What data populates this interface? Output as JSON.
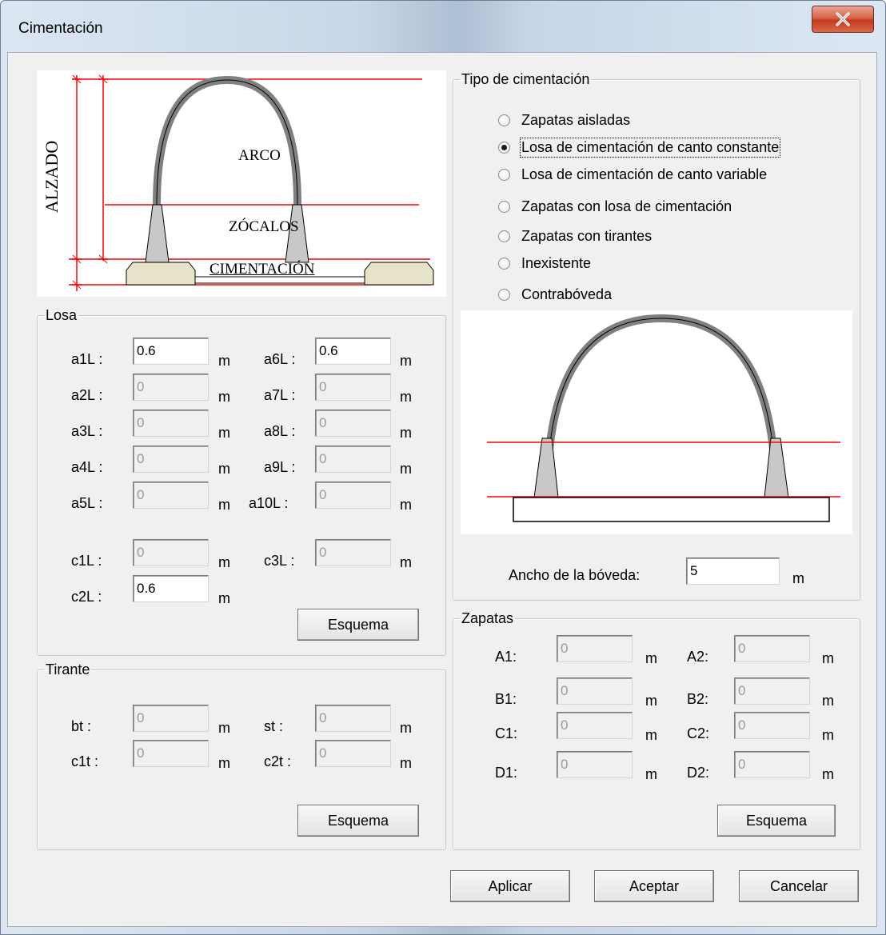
{
  "window": {
    "title": "Cimentación",
    "close_icon": "close-icon"
  },
  "elevation_diagram": {
    "side_label": "ALZADO",
    "arch_label": "ARCO",
    "plinth_label": "ZÓCALOS",
    "foundation_label": "CIMENTACIÓN"
  },
  "losa": {
    "legend": "Losa",
    "left": [
      {
        "label": "a1L :",
        "value": "0.6",
        "enabled": true,
        "unit": "m"
      },
      {
        "label": "a2L :",
        "value": "0",
        "enabled": false,
        "unit": "m"
      },
      {
        "label": "a3L :",
        "value": "0",
        "enabled": false,
        "unit": "m"
      },
      {
        "label": "a4L :",
        "value": "0",
        "enabled": false,
        "unit": "m"
      },
      {
        "label": "a5L :",
        "value": "0",
        "enabled": false,
        "unit": "m"
      },
      {
        "label": "c1L :",
        "value": "0",
        "enabled": false,
        "unit": "m"
      },
      {
        "label": "c2L :",
        "value": "0.6",
        "enabled": true,
        "unit": "m"
      }
    ],
    "right": [
      {
        "label": "a6L :",
        "value": "0.6",
        "enabled": true,
        "unit": "m"
      },
      {
        "label": "a7L :",
        "value": "0",
        "enabled": false,
        "unit": "m"
      },
      {
        "label": "a8L :",
        "value": "0",
        "enabled": false,
        "unit": "m"
      },
      {
        "label": "a9L :",
        "value": "0",
        "enabled": false,
        "unit": "m"
      },
      {
        "label": "a10L :",
        "value": "0",
        "enabled": false,
        "unit": "m"
      },
      {
        "label": "c3L :",
        "value": "0",
        "enabled": false,
        "unit": "m"
      }
    ],
    "scheme_button": "Esquema"
  },
  "tirante": {
    "legend": "Tirante",
    "fields": [
      {
        "label": "bt :",
        "value": "0",
        "unit": "m"
      },
      {
        "label": "st :",
        "value": "0",
        "unit": "m"
      },
      {
        "label": "c1t :",
        "value": "0",
        "unit": "m"
      },
      {
        "label": "c2t :",
        "value": "0",
        "unit": "m"
      }
    ],
    "scheme_button": "Esquema"
  },
  "tipo": {
    "legend": "Tipo de cimentación",
    "options": [
      {
        "label": "Zapatas aisladas",
        "selected": false
      },
      {
        "label": "Losa de cimentación de canto constante",
        "selected": true
      },
      {
        "label": "Losa de cimentación de canto variable",
        "selected": false
      },
      {
        "label": "Zapatas con losa de cimentación",
        "selected": false
      },
      {
        "label": "Zapatas con tirantes",
        "selected": false
      },
      {
        "label": "Inexistente",
        "selected": false
      },
      {
        "label": "Contrabóveda",
        "selected": false
      }
    ],
    "width_label": "Ancho de la bóveda:",
    "width_value": "5",
    "width_unit": "m"
  },
  "zapatas": {
    "legend": "Zapatas",
    "fields": [
      {
        "label": "A1:",
        "value": "0",
        "unit": "m"
      },
      {
        "label": "A2:",
        "value": "0",
        "unit": "m"
      },
      {
        "label": "B1:",
        "value": "0",
        "unit": "m"
      },
      {
        "label": "B2:",
        "value": "0",
        "unit": "m"
      },
      {
        "label": "C1:",
        "value": "0",
        "unit": "m"
      },
      {
        "label": "C2:",
        "value": "0",
        "unit": "m"
      },
      {
        "label": "D1:",
        "value": "0",
        "unit": "m"
      },
      {
        "label": "D2:",
        "value": "0",
        "unit": "m"
      }
    ],
    "scheme_button": "Esquema"
  },
  "footer": {
    "apply": "Aplicar",
    "accept": "Aceptar",
    "cancel": "Cancelar"
  },
  "colors": {
    "guide_line": "#ff0000",
    "arch_fill": "#808080",
    "footing_fill": "#e6e3c8"
  }
}
